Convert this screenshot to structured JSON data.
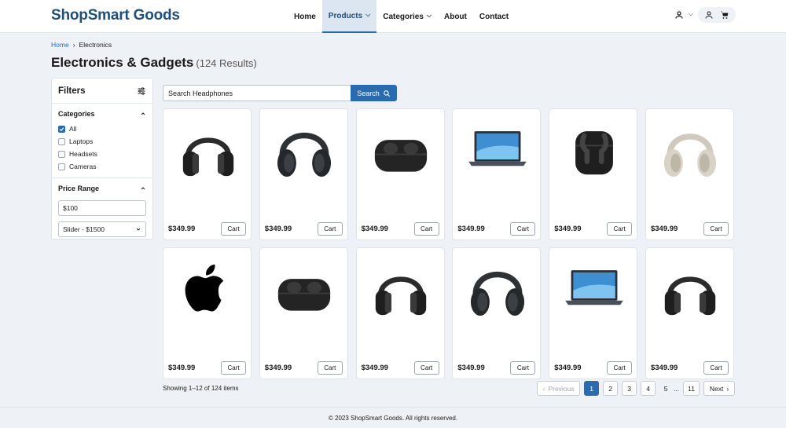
{
  "header": {
    "brand": "ShopSmart Goods",
    "nav": [
      {
        "label": "Home",
        "dropdown": false,
        "active": false
      },
      {
        "label": "Products",
        "dropdown": true,
        "active": true
      },
      {
        "label": "Categories",
        "dropdown": true,
        "active": false
      },
      {
        "label": "About",
        "dropdown": false,
        "active": false
      },
      {
        "label": "Contact",
        "dropdown": false,
        "active": false
      }
    ],
    "icons": [
      "user-icon",
      "account-icon",
      "cart-icon"
    ]
  },
  "breadcrumb": {
    "home": "Home",
    "current": "Electronics"
  },
  "page": {
    "title": "Electronics & Gadgets",
    "result_count": "(124 Results)"
  },
  "filters": {
    "title": "Filters",
    "categories_title": "Categories",
    "categories": [
      {
        "label": "All",
        "checked": true
      },
      {
        "label": "Laptops",
        "checked": false
      },
      {
        "label": "Headsets",
        "checked": false
      },
      {
        "label": "Cameras",
        "checked": false
      }
    ],
    "price_title": "Price Range",
    "price_min": "$100",
    "price_slider": "Slider - $1500"
  },
  "search": {
    "value": "Search Headphones",
    "button": "Search"
  },
  "products": [
    {
      "image": "headphones-black-icon",
      "price": "$349.99",
      "cart": "Cart"
    },
    {
      "image": "headphones-dark-icon",
      "price": "$349.99",
      "cart": "Cart"
    },
    {
      "image": "earbuds-case-icon",
      "price": "$349.99",
      "cart": "Cart"
    },
    {
      "image": "laptop-icon",
      "price": "$349.99",
      "cart": "Cart"
    },
    {
      "image": "earbuds-open-icon",
      "price": "$349.99",
      "cart": "Cart"
    },
    {
      "image": "headphones-silver-icon",
      "price": "$349.99",
      "cart": "Cart"
    },
    {
      "image": "apple-logo-icon",
      "price": "$349.99",
      "cart": "Cart"
    },
    {
      "image": "earbuds-case-icon",
      "price": "$349.99",
      "cart": "Cart"
    },
    {
      "image": "headphones-black-icon",
      "price": "$349.99",
      "cart": "Cart"
    },
    {
      "image": "headphones-dark-icon",
      "price": "$349.99",
      "cart": "Cart"
    },
    {
      "image": "laptop-icon",
      "price": "$349.99",
      "cart": "Cart"
    },
    {
      "image": "headphones-black-icon",
      "price": "$349.99",
      "cart": "Cart"
    }
  ],
  "listing": {
    "showing": "Showing 1–12 of 124 items"
  },
  "pagination": {
    "prev": "Previous",
    "pages": [
      "1",
      "2",
      "3",
      "4"
    ],
    "page5": "5",
    "ellipsis": "...",
    "last": "11",
    "next": "Next",
    "current": "1"
  },
  "footer": {
    "text": "© 2023 ShopSmart Goods. All rights reserved."
  },
  "colors": {
    "accent": "#2a6bb0",
    "brand": "#1f4e79",
    "background": "#eef2f6"
  }
}
